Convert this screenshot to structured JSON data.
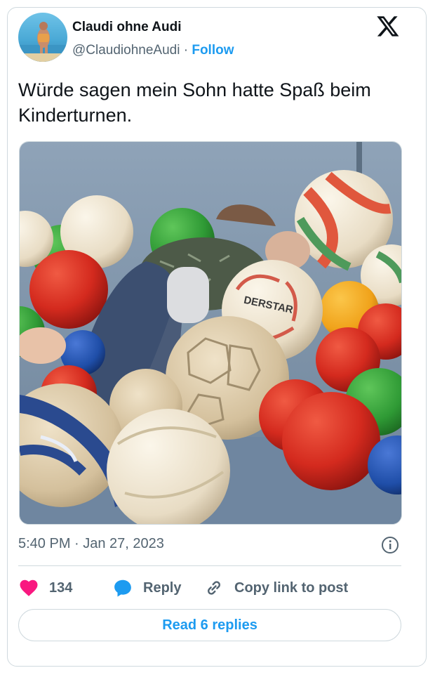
{
  "author": {
    "name": "Claudi ohne Audi",
    "handle": "@ClaudiohneAudi",
    "separator": "·",
    "follow_label": "Follow"
  },
  "tweet": {
    "text": "Würde sagen mein Sohn hatte Spaß beim Kinderturnen.",
    "timestamp": "5:40 PM · Jan 27, 2023"
  },
  "icons": {
    "brand": "x-logo-icon",
    "info": "info-icon",
    "like": "heart-icon",
    "reply": "speech-bubble-icon",
    "copy": "link-icon"
  },
  "actions": {
    "like_count": "134",
    "reply_label": "Reply",
    "copy_label": "Copy link to post"
  },
  "read_replies_label": "Read 6 replies",
  "colors": {
    "accent": "#1d9bf0",
    "like": "#f91880",
    "text": "#0f1419",
    "secondary": "#536471",
    "border": "#cfd9de"
  }
}
